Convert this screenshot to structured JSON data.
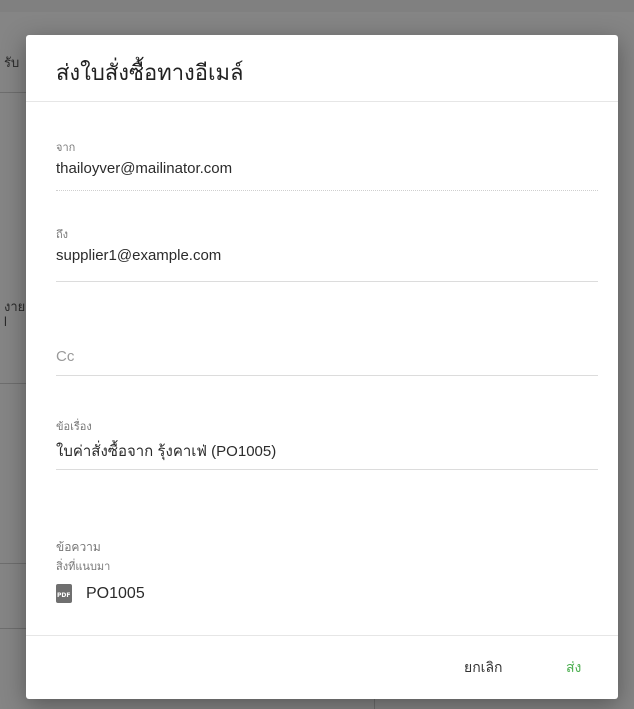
{
  "background": {
    "fragments": [
      "รับ",
      "งาย",
      "l"
    ]
  },
  "dialog": {
    "title": "ส่งใบสั่งซื้อทางอีเมล์",
    "from": {
      "label": "จาก",
      "value": "thailoyver@mailinator.com"
    },
    "to": {
      "label": "ถึง",
      "value": "supplier1@example.com"
    },
    "cc": {
      "placeholder": "Cc"
    },
    "subject": {
      "label": "ข้อเรื่อง",
      "value": "ใบค่าสั่งซื้อจาก รุ้งคาเฟ่ (PO1005)"
    },
    "message": {
      "label": "ข้อความ"
    },
    "attachments": {
      "label": "สิ่งที่แนบมา",
      "items": [
        {
          "name": "PO1005",
          "icon": "pdf-file-icon"
        }
      ]
    },
    "buttons": {
      "cancel": "ยกเลิก",
      "send": "ส่ง"
    }
  },
  "colors": {
    "accent": "#4caf50",
    "overlay": "#808080"
  }
}
